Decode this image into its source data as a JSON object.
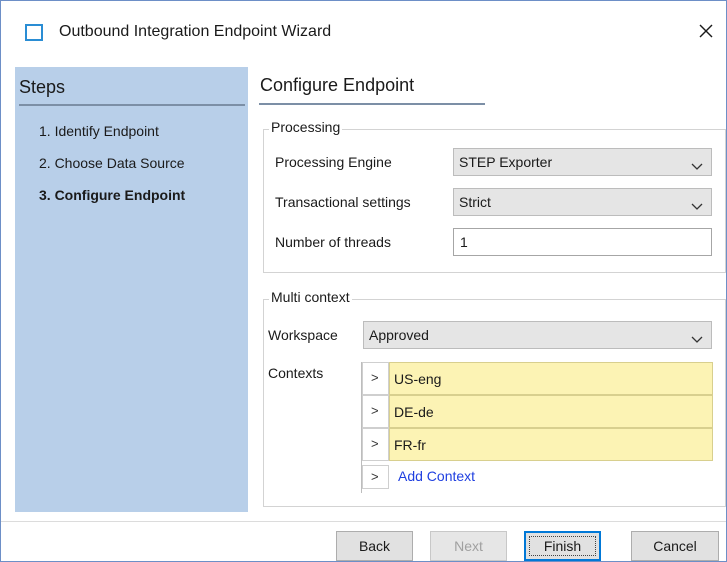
{
  "window": {
    "title": "Outbound Integration Endpoint Wizard",
    "icon": "window-icon",
    "close_icon": "close-icon"
  },
  "steps": {
    "title": "Steps",
    "items": [
      {
        "label": "1. Identify Endpoint",
        "current": false
      },
      {
        "label": "2. Choose Data Source",
        "current": false
      },
      {
        "label": "3. Configure Endpoint",
        "current": true
      }
    ]
  },
  "main": {
    "title": "Configure Endpoint",
    "processing": {
      "legend": "Processing",
      "engine_label": "Processing Engine",
      "engine_value": "STEP Exporter",
      "transactional_label": "Transactional settings",
      "transactional_value": "Strict",
      "threads_label": "Number of threads",
      "threads_value": "1"
    },
    "multi_context": {
      "legend": "Multi context",
      "workspace_label": "Workspace",
      "workspace_value": "Approved",
      "contexts_label": "Contexts",
      "contexts": [
        "US-eng",
        "DE-de",
        "FR-fr"
      ],
      "expand_glyph": ">",
      "add_context_label": "Add Context"
    }
  },
  "footer": {
    "back": "Back",
    "next": "Next",
    "finish": "Finish",
    "cancel": "Cancel"
  },
  "colors": {
    "steps_panel": "#b8cfe9",
    "context_row": "#fcf3b4",
    "link": "#1f3fe0",
    "title_icon_border": "#2a8dd4"
  }
}
